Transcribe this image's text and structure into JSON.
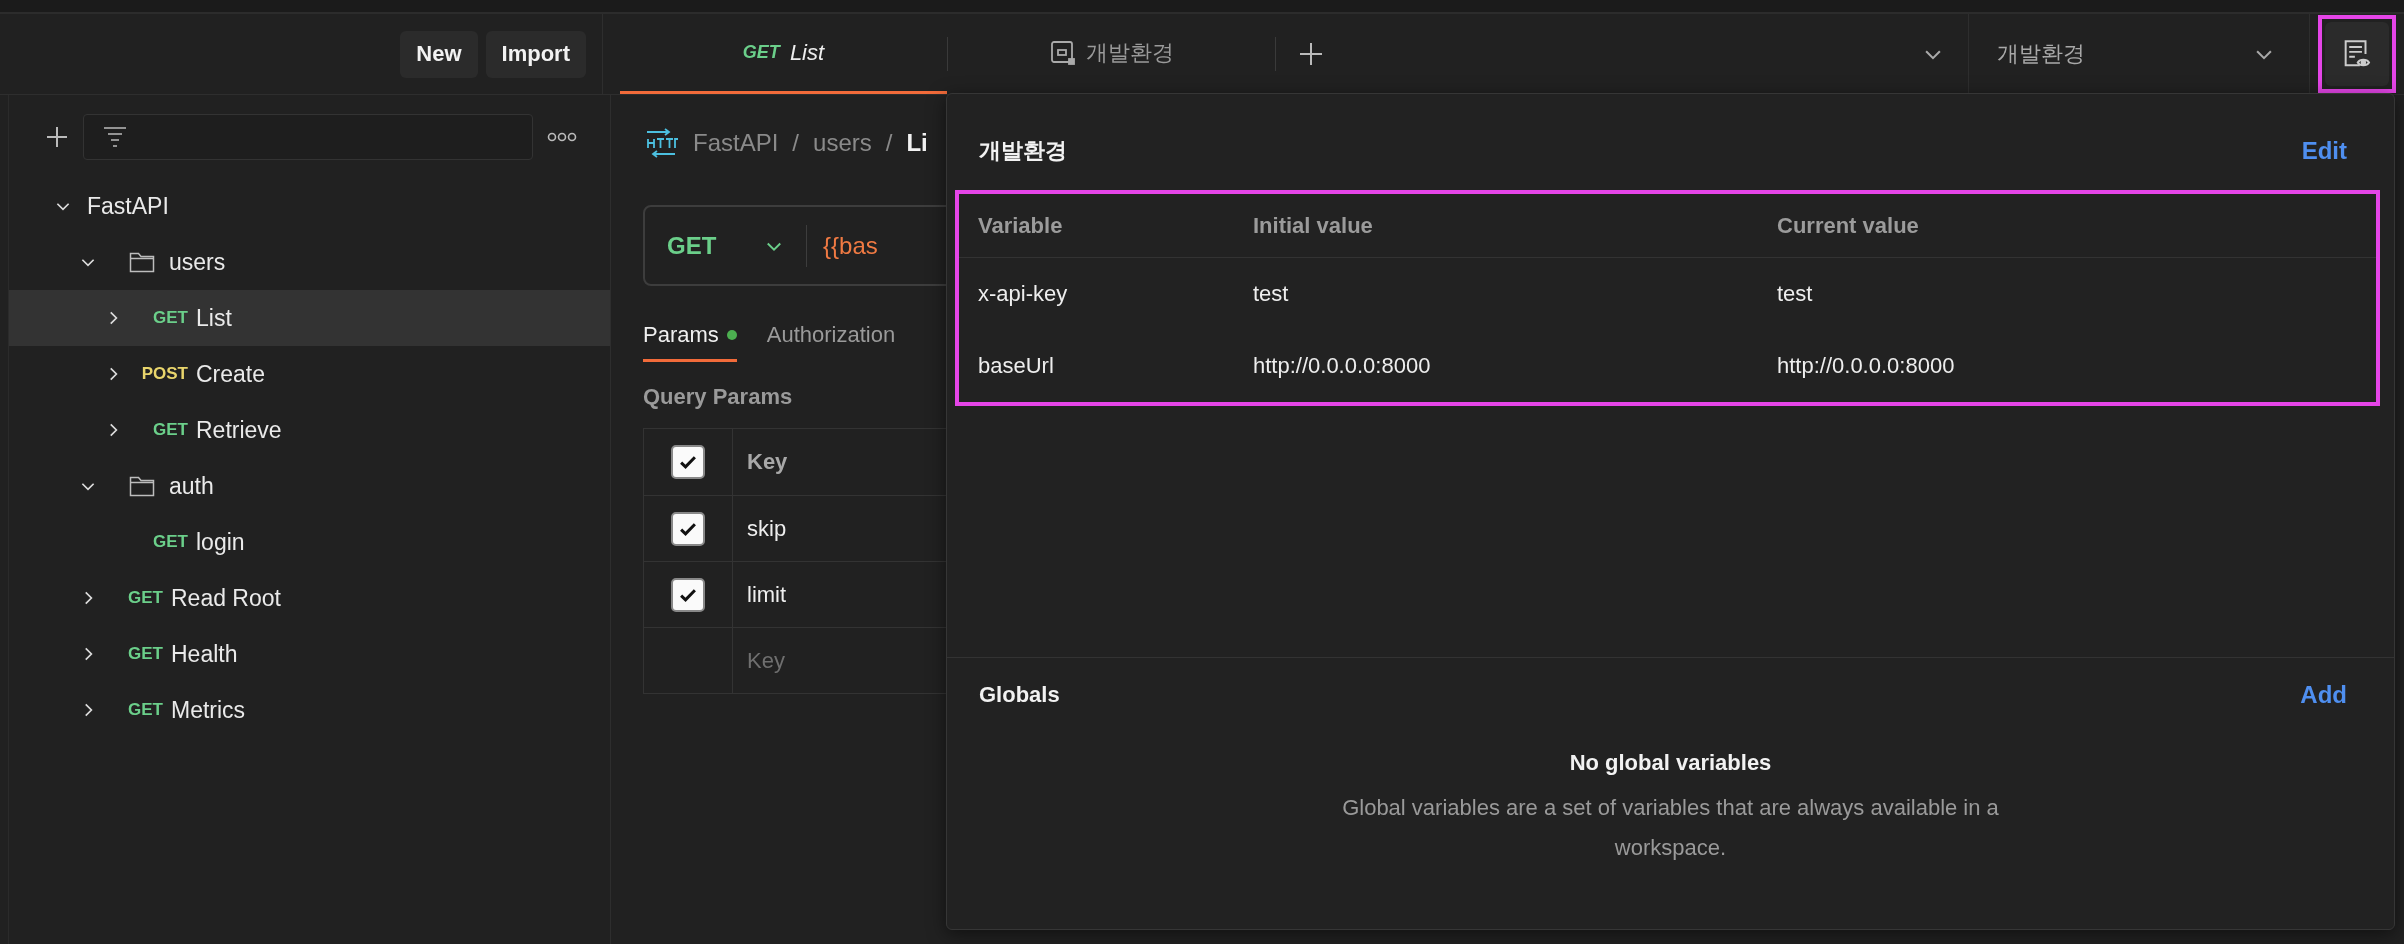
{
  "sidebar": {
    "buttons": [
      "New",
      "Import"
    ],
    "tree": [
      {
        "label": "FastAPI",
        "kind": "collection",
        "expanded": true,
        "children": [
          {
            "label": "users",
            "kind": "folder",
            "expanded": true,
            "children": [
              {
                "method": "GET",
                "color": "#6bcf8a",
                "label": "List",
                "kind": "request",
                "expanded": false,
                "selected": true
              },
              {
                "method": "POST",
                "color": "#e9d56c",
                "label": "Create",
                "kind": "request",
                "expanded": false,
                "selected": false
              },
              {
                "method": "GET",
                "color": "#6bcf8a",
                "label": "Retrieve",
                "kind": "request",
                "expanded": false,
                "selected": false
              }
            ]
          },
          {
            "label": "auth",
            "kind": "folder",
            "expanded": true,
            "children": [
              {
                "method": "GET",
                "color": "#6bcf8a",
                "label": "login",
                "kind": "request",
                "selected": false
              }
            ]
          },
          {
            "method": "GET",
            "color": "#6bcf8a",
            "label": "Read Root",
            "kind": "request",
            "expanded": false,
            "selected": false
          },
          {
            "method": "GET",
            "color": "#6bcf8a",
            "label": "Health",
            "kind": "request",
            "expanded": false,
            "selected": false
          },
          {
            "method": "GET",
            "color": "#6bcf8a",
            "label": "Metrics",
            "kind": "request",
            "expanded": false,
            "selected": false
          }
        ]
      }
    ]
  },
  "tabs": [
    {
      "kind": "request",
      "method": "GET",
      "color": "#6bcf8a",
      "label": "List",
      "selected": true
    },
    {
      "kind": "environment",
      "label": "개발환경",
      "selected": false
    }
  ],
  "environment_select": {
    "value": "개발환경"
  },
  "environment_button": {
    "highlighted": true
  },
  "request": {
    "breadcrumb": [
      "FastAPI",
      "users",
      "Li"
    ],
    "separators": [
      "/",
      "/"
    ],
    "method": "GET",
    "url": "{{bas",
    "tabs": [
      {
        "label": "Params",
        "selected": true,
        "dot": true
      },
      {
        "label": "Authorization",
        "selected": false,
        "dot": false
      }
    ],
    "section_title": "Query Params",
    "params": {
      "header": {
        "key": "Key",
        "checked": true
      },
      "rows": [
        {
          "key": "skip",
          "checked": true
        },
        {
          "key": "limit",
          "checked": true
        }
      ],
      "placeholder": "Key"
    }
  },
  "popover": {
    "title": "개발환경",
    "action": "Edit",
    "highlighted": true,
    "columns": [
      "Variable",
      "Initial value",
      "Current value"
    ],
    "rows": [
      [
        "x-api-key",
        "test",
        "test"
      ],
      [
        "baseUrl",
        "http://0.0.0.0:8000",
        "http://0.0.0.0:8000"
      ]
    ],
    "globals": {
      "title": "Globals",
      "action": "Add",
      "empty_title": "No global variables",
      "empty_text": "Global variables are a set of variables that are always available in a workspace."
    }
  }
}
